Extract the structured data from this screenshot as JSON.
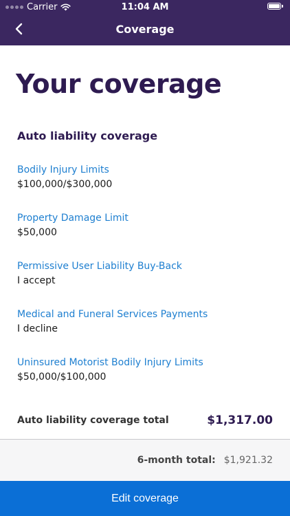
{
  "status_bar": {
    "carrier": "Carrier",
    "time": "11:04 AM"
  },
  "nav": {
    "title": "Coverage",
    "back_icon": "chevron-left-icon"
  },
  "page": {
    "title": "Your coverage",
    "section_title": "Auto liability coverage",
    "items": [
      {
        "label": "Bodily Injury Limits",
        "value": "$100,000/$300,000"
      },
      {
        "label": "Property Damage Limit",
        "value": "$50,000"
      },
      {
        "label": "Permissive User Liability Buy-Back",
        "value": "I accept"
      },
      {
        "label": "Medical and Funeral Services Payments",
        "value": "I decline"
      },
      {
        "label": "Uninsured Motorist Bodily Injury Limits",
        "value": "$50,000/$100,000"
      }
    ],
    "total_label": "Auto liability coverage total",
    "total_value": "$1,317.00"
  },
  "summary": {
    "label": "6-month total:",
    "value": "$1,921.32"
  },
  "edit_button": {
    "label": "Edit coverage"
  },
  "colors": {
    "header_bg": "#3b2760",
    "title": "#2e1b51",
    "link": "#1e7fd0",
    "button_bg": "#0b6fd6"
  }
}
